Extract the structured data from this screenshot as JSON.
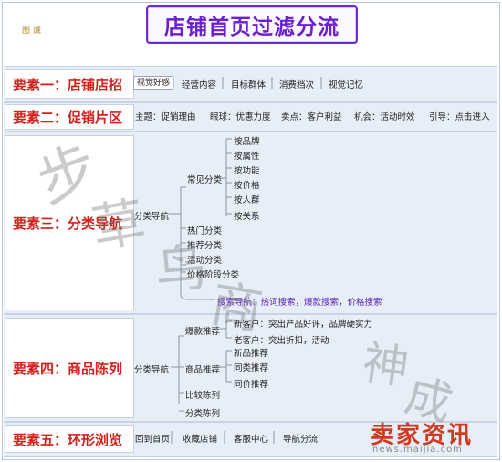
{
  "header": {
    "title": "店铺首页过滤分流",
    "corner_icon": "图 诚"
  },
  "sections": [
    {
      "label": "要素一：店铺店招",
      "chips": [
        "视觉好感",
        "经营内容",
        "目标群体",
        "消费档次",
        "视觉记忆"
      ]
    },
    {
      "label": "要素二：促销片区",
      "items": [
        "主题：促销理由",
        "眼球：优惠力度",
        "卖点：客户利益",
        "机会：活动时效",
        "引导：点击进入"
      ]
    },
    {
      "label": "要素三：分类导航",
      "root": "分类导航",
      "common_group": "常见分类",
      "common_items": [
        "按品牌",
        "按属性",
        "按功能",
        "按价格",
        "按人群",
        "按关系"
      ],
      "other_items": [
        "热门分类",
        "推荐分类",
        "活动分类",
        "价格阶段分类"
      ],
      "search_line": "搜索导航：热词搜索，爆款搜索，价格搜索"
    },
    {
      "label": "要素四：商品陈列",
      "root": "分类导航",
      "hot": "爆款推荐",
      "hot_items": [
        "新客户：突出产品好评，品牌硬实力",
        "老客户：突出折扣，活动"
      ],
      "rec": "商品推荐",
      "rec_items": [
        "新品推荐",
        "同类推荐",
        "同价推荐"
      ],
      "others": [
        "比较陈列",
        "分类陈列"
      ]
    },
    {
      "label": "要素五：环形浏览",
      "items": [
        "回到首页",
        "收藏店铺",
        "客服中心",
        "导航分流"
      ]
    }
  ],
  "watermark": {
    "chars": [
      "步",
      "草",
      "鸟",
      "商",
      "神",
      "成"
    ]
  },
  "logo": {
    "main": "卖家资讯",
    "url": "news.maijia.com"
  },
  "colors": {
    "title": "#6a1fd1",
    "label": "#d2221d",
    "band": "#e7eef8",
    "link": "#5a27b8",
    "logo": "#d23a20"
  }
}
